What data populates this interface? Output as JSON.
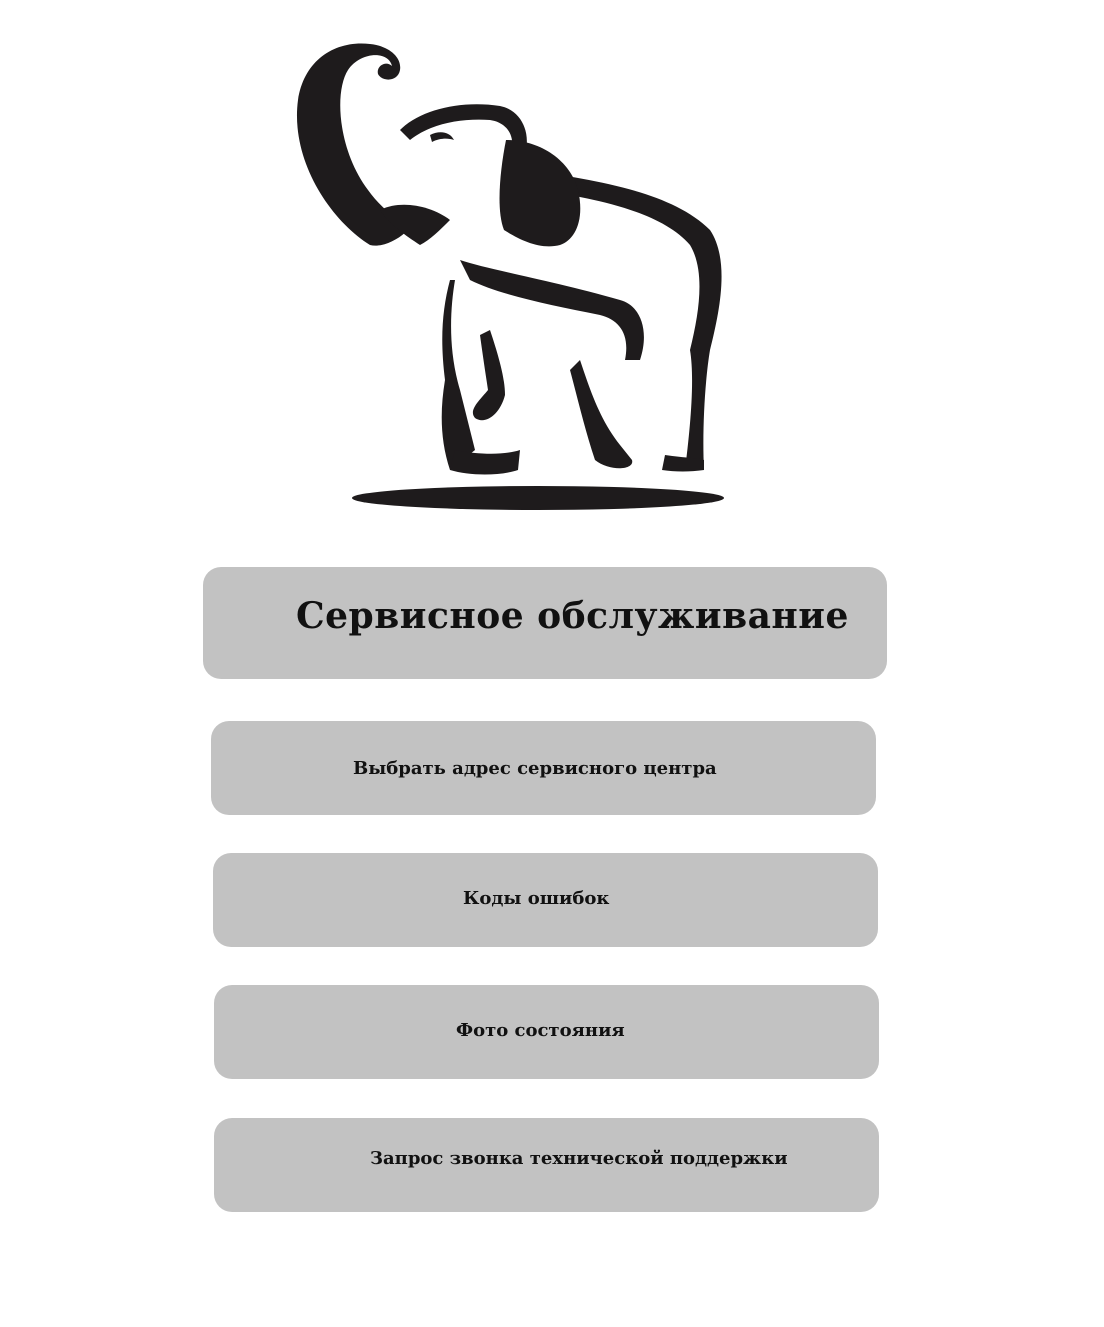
{
  "header": {
    "title": "Сервисное обслуживание"
  },
  "logo": {
    "icon": "elephant-icon"
  },
  "menu": {
    "items": [
      {
        "label": "Выбрать адрес сервисного центра"
      },
      {
        "label": "Коды ошибок"
      },
      {
        "label": "Фото состояния"
      },
      {
        "label": "Запрос звонка технической поддержки"
      }
    ]
  },
  "colors": {
    "background": "#ffffff",
    "button": "#c2c2c2",
    "text": "#111111",
    "logo": "#1e1b1c"
  }
}
